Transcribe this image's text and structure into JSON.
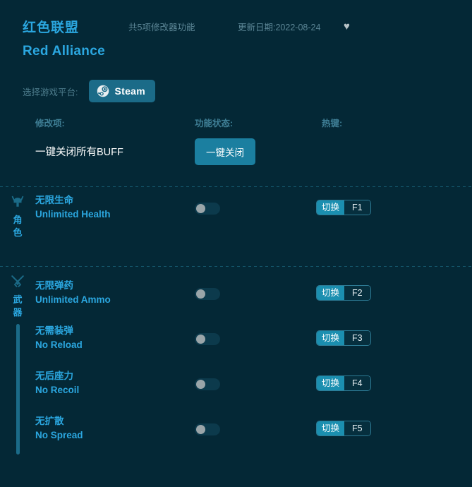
{
  "header": {
    "title_cn": "红色联盟",
    "title_en": "Red Alliance",
    "feature_count": "共5项修改器功能",
    "update_date": "更新日期:2022-08-24",
    "favorite_icon": "♥"
  },
  "platform": {
    "label": "选择游戏平台:",
    "selected": "Steam",
    "icon": "steam-icon"
  },
  "columns": {
    "modifier": "修改项:",
    "status": "功能状态:",
    "hotkey": "热键:"
  },
  "onekey": {
    "label": "一键关闭所有BUFF",
    "button": "一键关闭"
  },
  "sections": [
    {
      "name": "角色",
      "icon": "character-helmet-icon",
      "rows": [
        {
          "cn": "无限生命",
          "en": "Unlimited Health",
          "toggle_on": false,
          "hotkey_action": "切换",
          "hotkey_key": "F1"
        }
      ]
    },
    {
      "name": "武器",
      "icon": "crossed-swords-icon",
      "rows": [
        {
          "cn": "无限弹药",
          "en": "Unlimited Ammo",
          "toggle_on": false,
          "hotkey_action": "切换",
          "hotkey_key": "F2"
        },
        {
          "cn": "无需装弹",
          "en": "No Reload",
          "toggle_on": false,
          "hotkey_action": "切换",
          "hotkey_key": "F3"
        },
        {
          "cn": "无后座力",
          "en": "No Recoil",
          "toggle_on": false,
          "hotkey_action": "切换",
          "hotkey_key": "F4"
        },
        {
          "cn": "无扩散",
          "en": "No Spread",
          "toggle_on": false,
          "hotkey_action": "切换",
          "hotkey_key": "F5"
        }
      ]
    }
  ],
  "colors": {
    "background": "#042836",
    "accent": "#2ba7e0",
    "muted": "#4d7c8c",
    "button": "#1b7fa0",
    "platform_button": "#1b6b88"
  }
}
